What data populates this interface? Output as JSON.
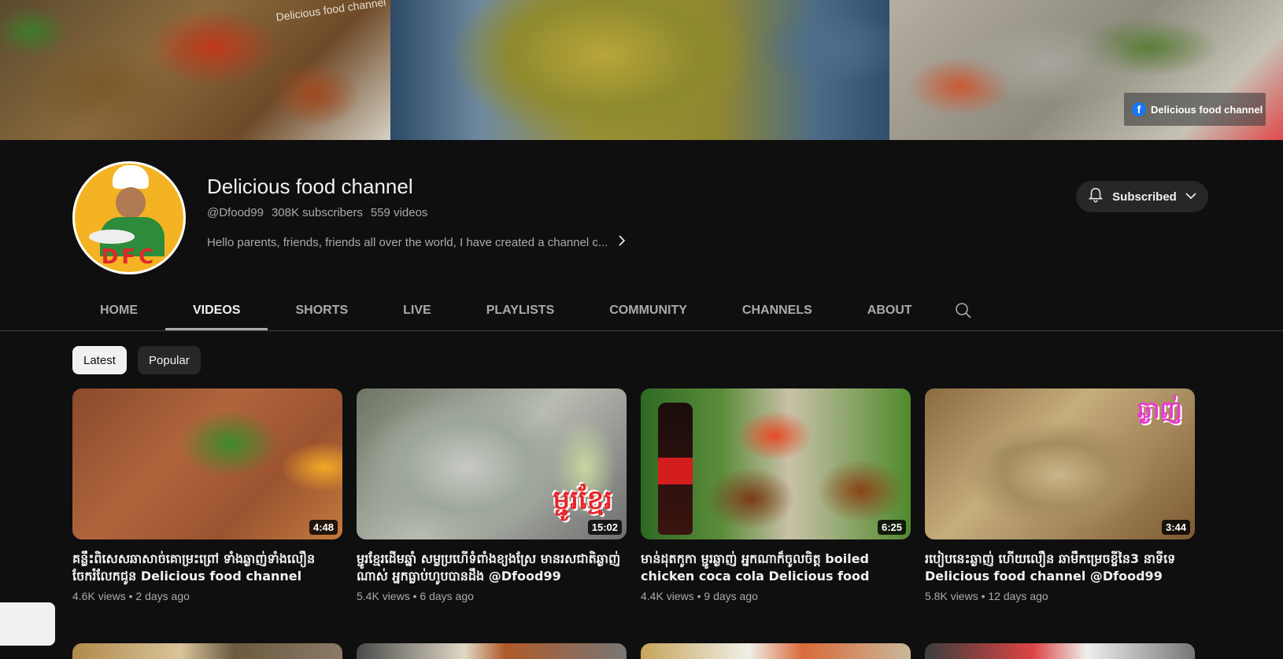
{
  "banner": {
    "watermark": "Delicious food channel",
    "fb_label": "Delicious food channel",
    "fb_icon": "f"
  },
  "channel": {
    "avatar_text": "DFC",
    "name": "Delicious food channel",
    "handle": "@Dfood99",
    "subscribers": "308K subscribers",
    "videos_count": "559 videos",
    "description": "Hello parents, friends, friends all over the world, I have created a channel c...",
    "subscribe_label": "Subscribed"
  },
  "tabs": [
    {
      "label": "HOME"
    },
    {
      "label": "VIDEOS"
    },
    {
      "label": "SHORTS"
    },
    {
      "label": "LIVE"
    },
    {
      "label": "PLAYLISTS"
    },
    {
      "label": "COMMUNITY"
    },
    {
      "label": "CHANNELS"
    },
    {
      "label": "ABOUT"
    }
  ],
  "active_tab": "VIDEOS",
  "chips": {
    "latest": "Latest",
    "popular": "Popular"
  },
  "videos": [
    {
      "title": "គន្លឹះពិសេសឆាសាច់គោម្រះព្រៅ ទាំងឆ្ងាញ់ទាំងលឿន ចែករំលែកជូន Delicious food channel",
      "duration": "4:48",
      "views": "4.6K views",
      "age": "2 days ago"
    },
    {
      "title": "ម្ជូរខ្មែរដើមឆ្នាំ សម្លប្រហើទំពាំងខ្យងស្រែ មានរសជាតិឆ្ងាញ់ណាស់ អ្នកធ្លាប់ហូបបានដឹង @Dfood99",
      "duration": "15:02",
      "views": "5.4K views",
      "age": "6 days ago",
      "overlay_text": "ម្ជូរខ្មែរ"
    },
    {
      "title": "មាន់ដុតកូកា ម្ជូរឆ្ងាញ់ អ្នកណាក៏ចូលចិត្ត boiled chicken coca cola Delicious food channe...",
      "duration": "6:25",
      "views": "4.4K views",
      "age": "9 days ago"
    },
    {
      "title": "របៀបនេះឆ្ងាញ់ ហើយលឿន ឆាមឹកម្រេចខ្ចីនៃ3 នាទីទេ Delicious food channel @Dfood99",
      "duration": "3:44",
      "views": "5.8K views",
      "age": "12 days ago",
      "overlay_text": "ឆ្ងាញ់"
    }
  ],
  "meta_separator": "•"
}
